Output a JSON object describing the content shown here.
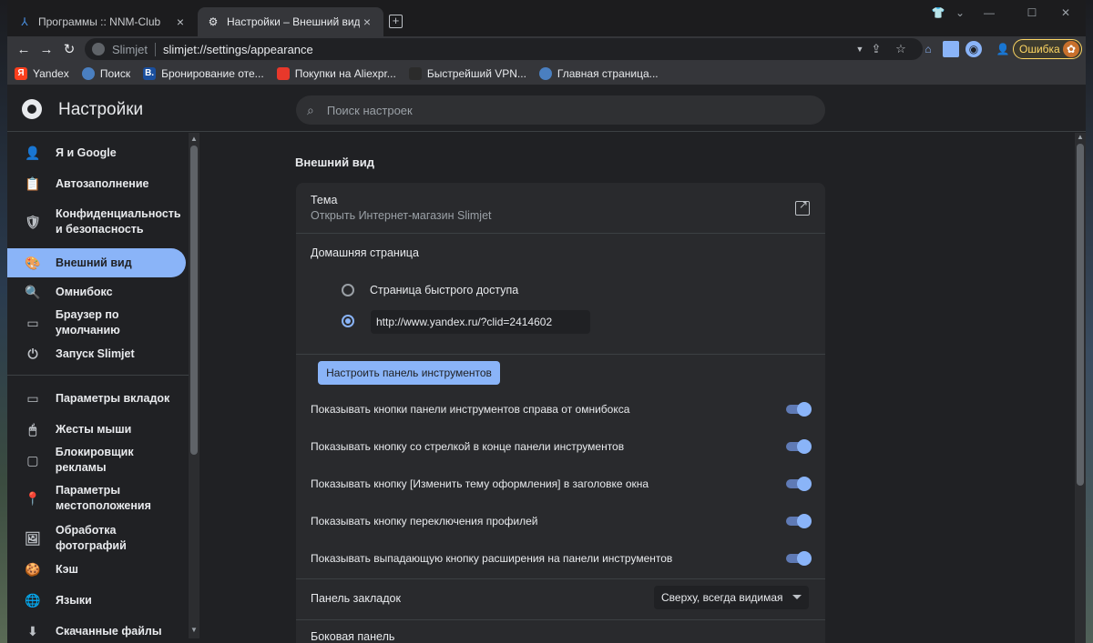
{
  "tabs": [
    {
      "title": "Программы :: NNM-Club",
      "icon": "nnm-favicon"
    },
    {
      "title": "Настройки – Внешний вид",
      "icon": "gear-icon"
    }
  ],
  "toolbar": {
    "site_name": "Slimjet",
    "url": "slimjet://settings/appearance",
    "error_label": "Ошибка"
  },
  "bookmarks": [
    {
      "label": "Yandex",
      "icon": "yandex-icon",
      "color": "#fc3f1d",
      "glyph": "Я"
    },
    {
      "label": "Поиск",
      "icon": "globe-icon",
      "color": "#4a7fc0",
      "glyph": ""
    },
    {
      "label": "Бронирование оте...",
      "icon": "booking-icon",
      "color": "#1a4f9e",
      "glyph": "B."
    },
    {
      "label": "Покупки на Aliexpr...",
      "icon": "aliexpress-icon",
      "color": "#e8382b",
      "glyph": ""
    },
    {
      "label": "Быстрейший VPN...",
      "icon": "vpn-icon",
      "color": "#2b2b2b",
      "glyph": ""
    },
    {
      "label": "Главная страница...",
      "icon": "globe-icon",
      "color": "#4a7fc0",
      "glyph": ""
    }
  ],
  "header": {
    "title": "Настройки",
    "search_placeholder": "Поиск настроек"
  },
  "sidebar": {
    "items": [
      {
        "label": "Я и Google",
        "icon": "person-icon",
        "glyph": "👤"
      },
      {
        "label": "Автозаполнение",
        "icon": "clipboard-icon",
        "glyph": "📋"
      },
      {
        "label": "Конфиденциальность и безопасность",
        "icon": "shield-icon",
        "glyph": "🛡"
      },
      {
        "label": "Внешний вид",
        "icon": "palette-icon",
        "glyph": "🎨",
        "active": true
      },
      {
        "label": "Омнибокс",
        "icon": "search-icon",
        "glyph": "🔍"
      },
      {
        "label": "Браузер по умолчанию",
        "icon": "browser-icon",
        "glyph": "▭"
      },
      {
        "label": "Запуск Slimjet",
        "icon": "power-icon",
        "glyph": "⏻"
      },
      {
        "label": "Параметры вкладок",
        "icon": "tab-icon",
        "glyph": "▭"
      },
      {
        "label": "Жесты мыши",
        "icon": "mouse-icon",
        "glyph": "🖱"
      },
      {
        "label": "Блокировщик рекламы",
        "icon": "window-icon",
        "glyph": "▢"
      },
      {
        "label": "Параметры местоположения",
        "icon": "location-icon",
        "glyph": "📍"
      },
      {
        "label": "Обработка фотографий",
        "icon": "image-icon",
        "glyph": "🖼"
      },
      {
        "label": "Кэш",
        "icon": "cookie-icon",
        "glyph": "🍪"
      },
      {
        "label": "Языки",
        "icon": "globe-icon",
        "glyph": "🌐"
      },
      {
        "label": "Скачанные файлы",
        "icon": "download-icon",
        "glyph": "⬇"
      }
    ]
  },
  "main": {
    "section_title": "Внешний вид",
    "theme": {
      "label": "Тема",
      "sub": "Открыть Интернет-магазин Slimjet"
    },
    "homepage": {
      "label": "Домашняя страница",
      "option_quick": "Страница быстрого доступа",
      "custom_url": "http://www.yandex.ru/?clid=2414602",
      "selected": "custom"
    },
    "customize_button": "Настроить панель инструментов",
    "toggles": [
      {
        "label": "Показывать кнопки панели инструментов справа от омнибокса",
        "on": true
      },
      {
        "label": "Показывать кнопку со стрелкой в конце панели инструментов",
        "on": true
      },
      {
        "label": "Показывать кнопку [Изменить тему оформления] в заголовке окна",
        "on": true
      },
      {
        "label": "Показывать кнопку переключения профилей",
        "on": true
      },
      {
        "label": "Показывать выпадающую кнопку расширения на панели инструментов",
        "on": true
      }
    ],
    "bookmarks_bar": {
      "label": "Панель закладок",
      "value": "Сверху, всегда видимая"
    },
    "side_panel": {
      "label": "Боковая панель"
    }
  }
}
